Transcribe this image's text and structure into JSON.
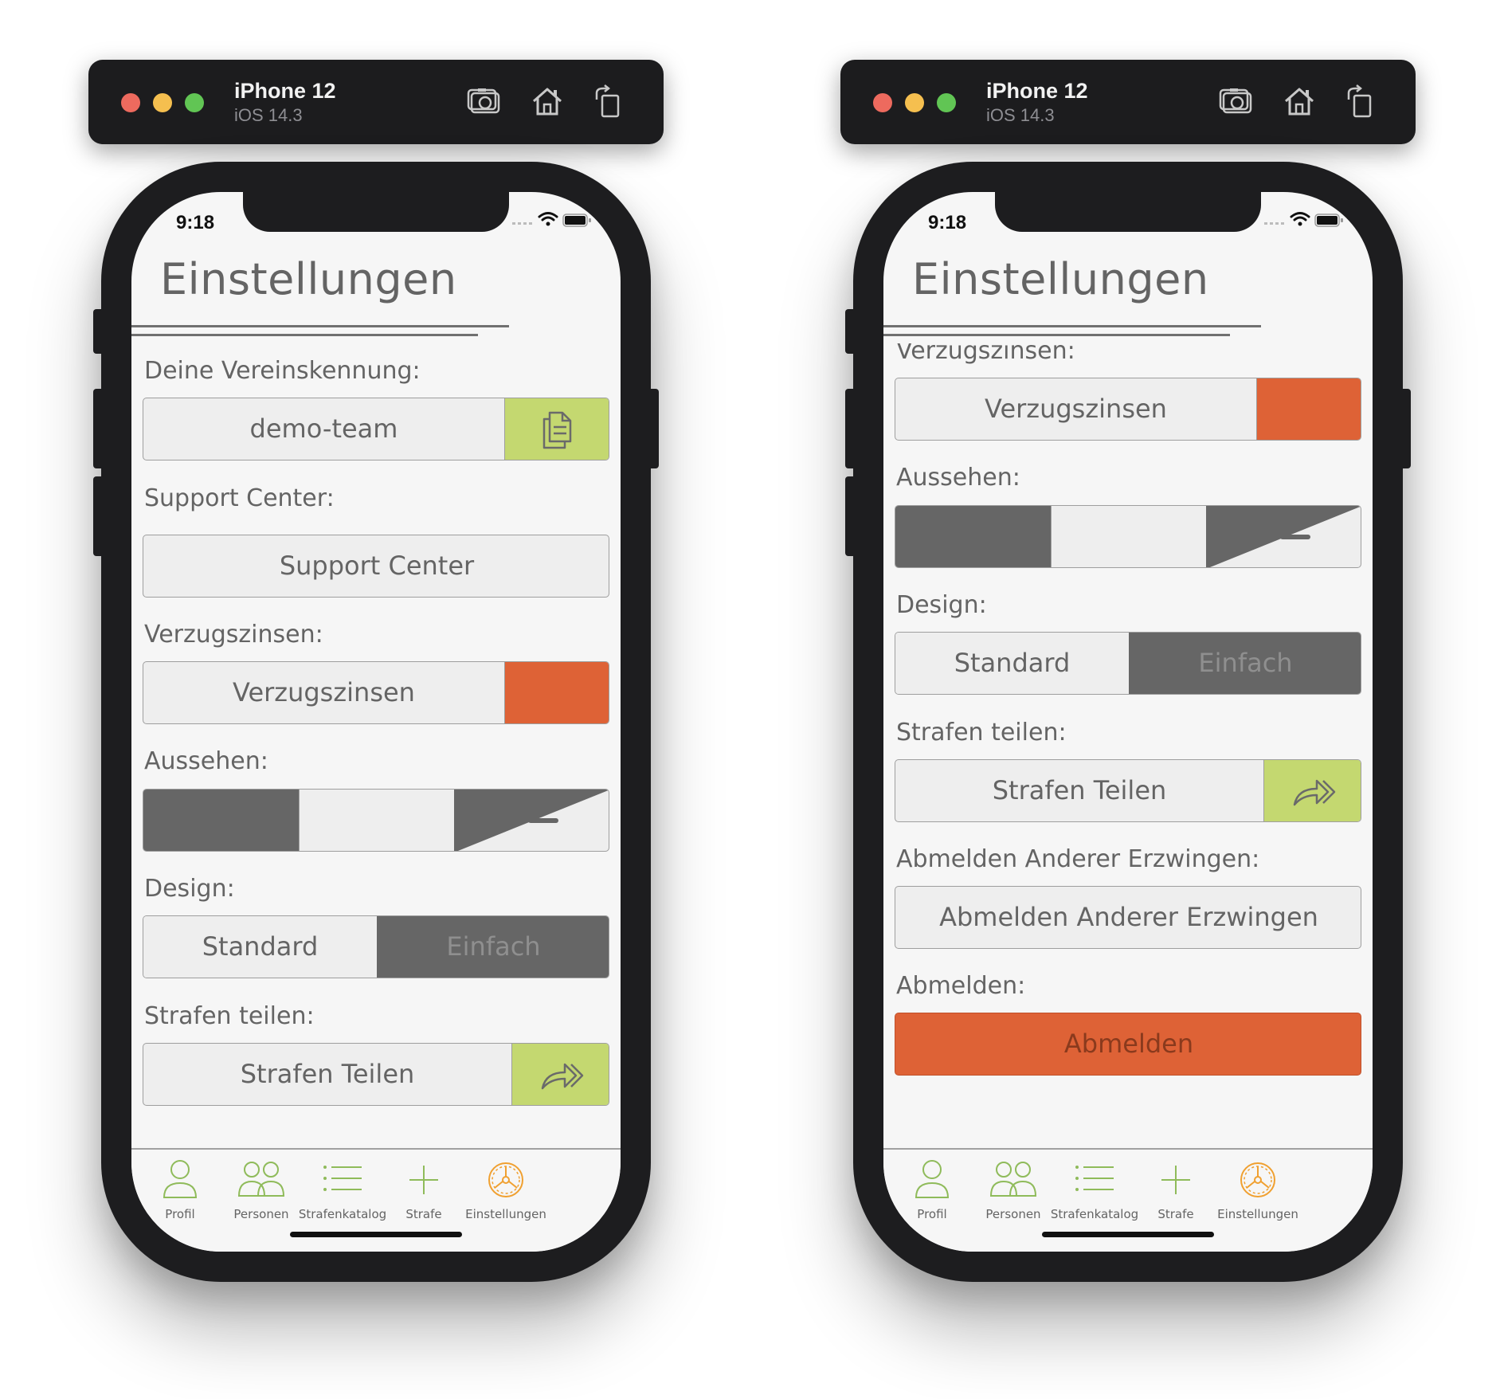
{
  "simulators": [
    {
      "device": "iPhone 12",
      "os": "iOS 14.3",
      "status_time": "9:18",
      "page_title": "Einstellungen",
      "sections": {
        "vereinskennung": {
          "label": "Deine Vereinskennung:",
          "value": "demo-team",
          "icon": "copy-icon"
        },
        "support": {
          "label": "Support Center:",
          "button": "Support Center"
        },
        "verzugszinsen": {
          "label": "Verzugszinsen:",
          "button": "Verzugszinsen",
          "toggle_color": "#de6236"
        },
        "aussehen": {
          "label": "Aussehen:",
          "options": [
            "dark",
            "light",
            "system"
          ]
        },
        "design": {
          "label": "Design:",
          "standard": "Standard",
          "einfach": "Einfach"
        },
        "strafen_teilen": {
          "label": "Strafen teilen:",
          "button": "Strafen Teilen",
          "icon": "share-arrow-icon"
        }
      }
    },
    {
      "device": "iPhone 12",
      "os": "iOS 14.3",
      "status_time": "9:18",
      "page_title": "Einstellungen",
      "sections": {
        "verzugszinsen": {
          "label": "Verzugszinsen:",
          "button": "Verzugszinsen",
          "toggle_color": "#de6236"
        },
        "aussehen": {
          "label": "Aussehen:",
          "options": [
            "dark",
            "light",
            "system"
          ]
        },
        "design": {
          "label": "Design:",
          "standard": "Standard",
          "einfach": "Einfach"
        },
        "strafen_teilen": {
          "label": "Strafen teilen:",
          "button": "Strafen Teilen",
          "icon": "share-arrow-icon"
        },
        "abmelden_andere": {
          "label": "Abmelden Anderer Erzwingen:",
          "button": "Abmelden Anderer Erzwingen"
        },
        "abmelden": {
          "label": "Abmelden:",
          "button": "Abmelden"
        }
      }
    }
  ],
  "tabs": [
    {
      "label": "Profil",
      "icon": "person-icon",
      "active": false
    },
    {
      "label": "Personen",
      "icon": "people-icon",
      "active": false
    },
    {
      "label": "Strafenkatalog",
      "icon": "list-icon",
      "active": false
    },
    {
      "label": "Strafe",
      "icon": "plus-icon",
      "active": false
    },
    {
      "label": "Einstellungen",
      "icon": "gear-wheel-icon",
      "active": true
    }
  ],
  "colors": {
    "accent_green": "#c4d870",
    "accent_orange": "#de6236",
    "tab_green": "#8fbb5a",
    "tab_active": "#f0a030",
    "dark_gray": "#666666"
  }
}
